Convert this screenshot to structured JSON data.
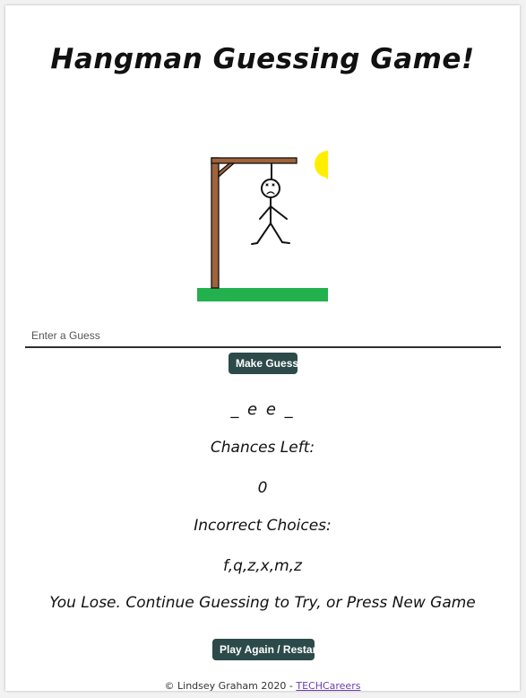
{
  "title": "Hangman Guessing Game!",
  "word_display": "_ e e _",
  "input": {
    "placeholder": "Enter a Guess",
    "value": ""
  },
  "buttons": {
    "make_guess": "Make Guess",
    "play_again": "Play Again / Restart"
  },
  "chances": {
    "label": "Chances Left:",
    "value": "0"
  },
  "incorrect": {
    "label": "Incorrect Choices:",
    "value": "f,q,z,x,m,z"
  },
  "result_message": "You Lose. Continue Guessing to Try, or Press New Game",
  "footer": {
    "text": "© Lindsey Graham 2020 - ",
    "link_text": "TECHCareers"
  },
  "colors": {
    "button_bg": "#2c4a4a",
    "gallows": "#a0633c",
    "grass": "#22b14c",
    "sun": "#ffee00",
    "link": "#6a3fb0"
  },
  "scene": {
    "icons": [
      "gallows-icon",
      "stick-figure-icon",
      "sun-icon",
      "grass-icon"
    ],
    "figure_state": "dead"
  }
}
